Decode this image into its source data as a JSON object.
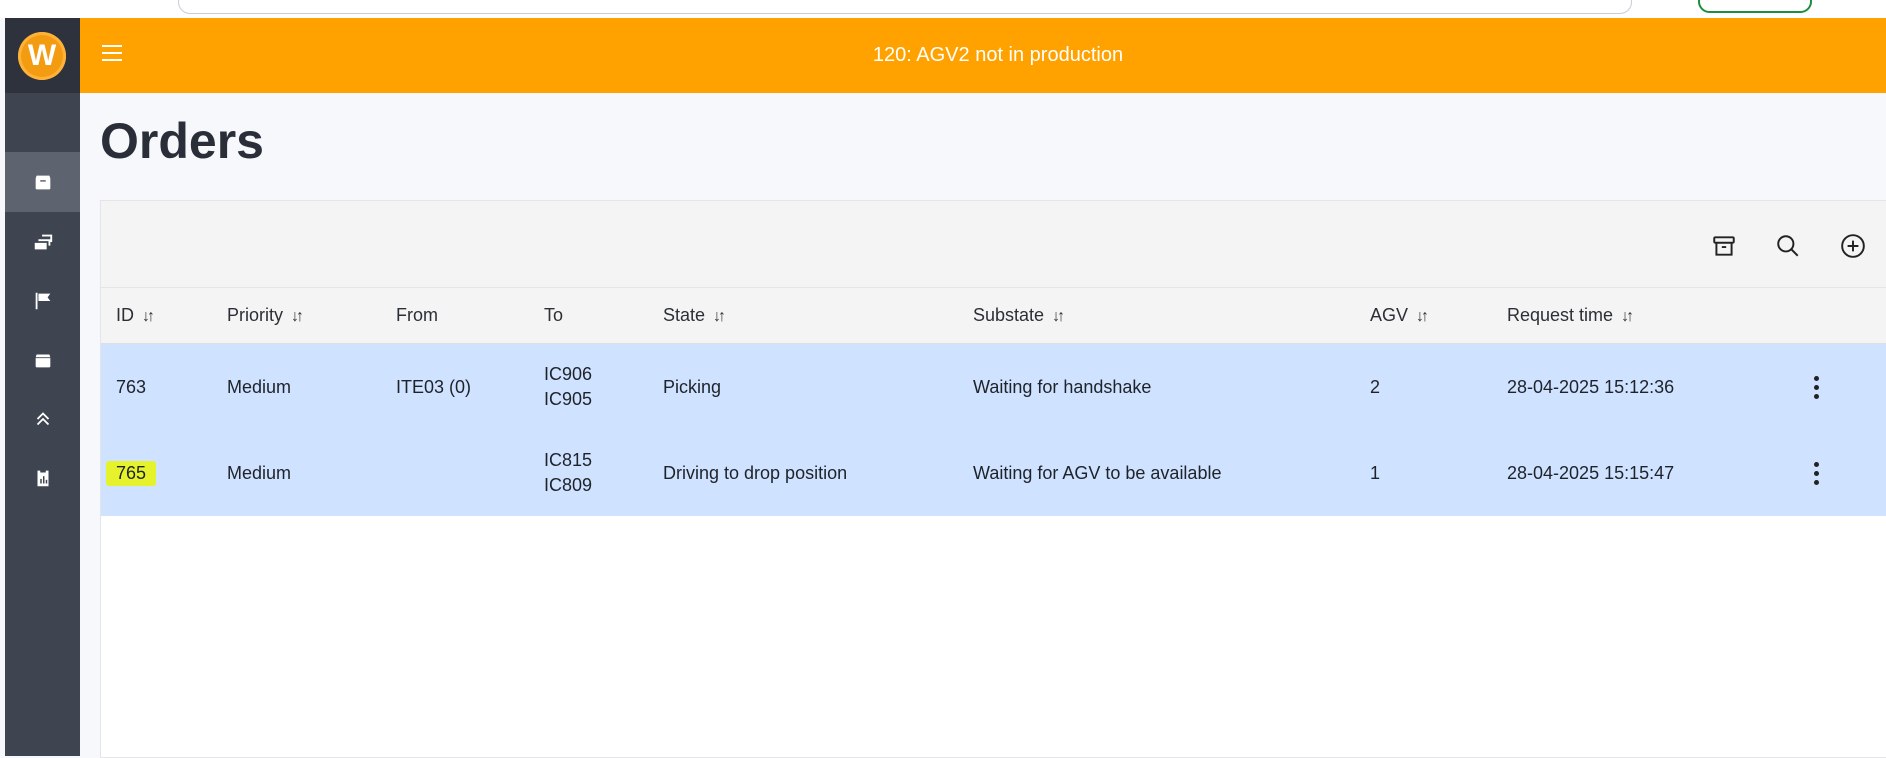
{
  "topbar": {
    "title": "120: AGV2 not in production"
  },
  "logo": {
    "letter": "W"
  },
  "sidebar": {
    "items": [
      {
        "icon": "map-icon"
      },
      {
        "icon": "orders-box-icon",
        "active": true
      },
      {
        "icon": "layers-icon"
      },
      {
        "icon": "flag-icon"
      },
      {
        "icon": "storage-icon"
      },
      {
        "icon": "chevrons-up-icon"
      },
      {
        "icon": "report-clipboard-icon"
      }
    ]
  },
  "page": {
    "title": "Orders"
  },
  "toolbar": {
    "icons": [
      "archive-icon",
      "search-icon",
      "add-circle-icon"
    ]
  },
  "table": {
    "columns": [
      "ID",
      "Priority",
      "From",
      "To",
      "State",
      "Substate",
      "AGV",
      "Request time"
    ],
    "rows": [
      {
        "id": "763",
        "priority": "Medium",
        "from": "ITE03 (0)",
        "to": [
          "IC906",
          "IC905"
        ],
        "state": "Picking",
        "substate": "Waiting for handshake",
        "agv": "2",
        "request_time": "28-04-2025 15:12:36"
      },
      {
        "id": "765",
        "priority": "Medium",
        "from": "",
        "to": [
          "IC815",
          "IC809"
        ],
        "state": "Driving to drop position",
        "substate": "Waiting for AGV to be available",
        "agv": "1",
        "request_time": "28-04-2025 15:15:47",
        "id_highlighted": true
      }
    ]
  },
  "colors": {
    "accent": "#ffa200",
    "sidebar": "#3e4450",
    "row": "#cfe2ff",
    "highlight": "#e6f22b"
  }
}
